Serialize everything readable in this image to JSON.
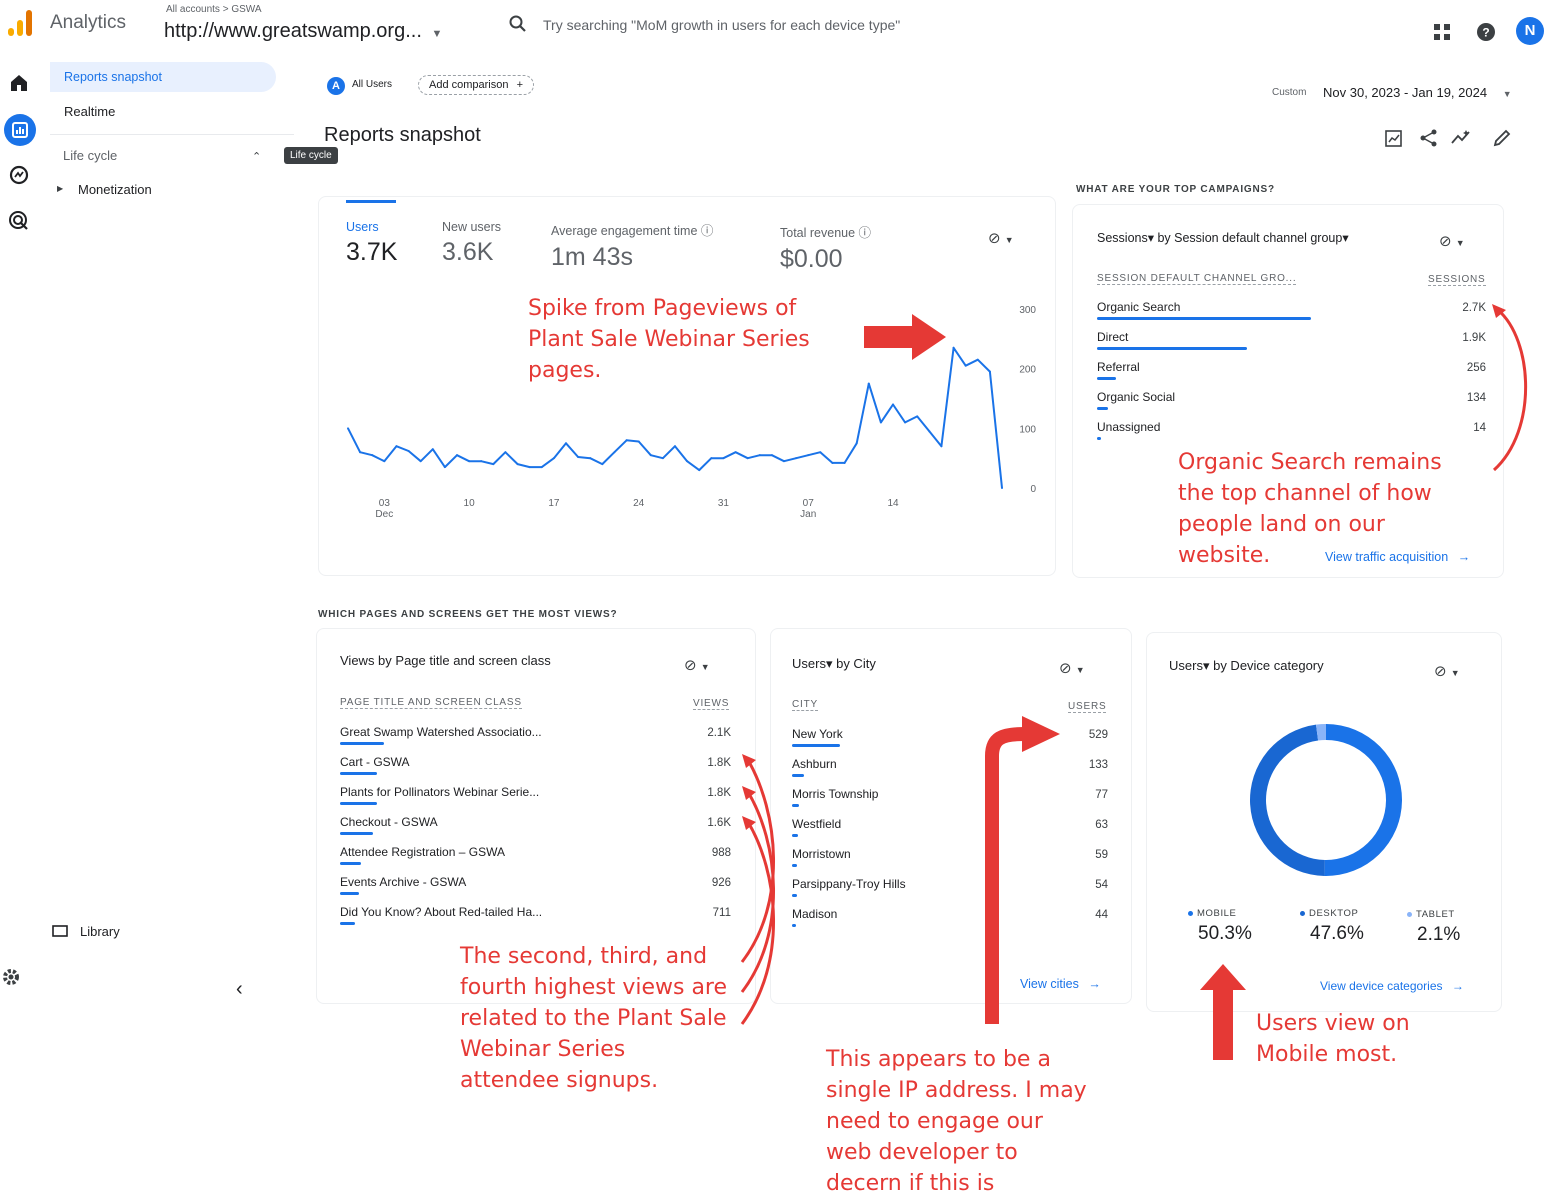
{
  "header": {
    "app_title": "Analytics",
    "breadcrumb": "All accounts > GSWA",
    "property": "http://www.greatswamp.org...",
    "search_placeholder": "Try searching \"MoM growth in users for each device type\"",
    "avatar_letter": "N"
  },
  "nav": {
    "reports_snapshot": "Reports snapshot",
    "realtime": "Realtime",
    "life_cycle": "Life cycle",
    "monetization": "Monetization",
    "library": "Library",
    "tooltip": "Life cycle"
  },
  "toolbar": {
    "segment_letter": "A",
    "segment_label": "All Users",
    "add_comparison": "Add comparison",
    "page_title": "Reports snapshot",
    "date_custom": "Custom",
    "date_range": "Nov 30, 2023 - Jan 19, 2024"
  },
  "metrics": [
    {
      "label": "Users",
      "value": "3.7K"
    },
    {
      "label": "New users",
      "value": "3.6K"
    },
    {
      "label": "Average engagement time",
      "value": "1m 43s"
    },
    {
      "label": "Total revenue",
      "value": "$0.00"
    }
  ],
  "chart_data": {
    "type": "line",
    "x_ticks": [
      "03 Dec",
      "10",
      "17",
      "24",
      "31",
      "07 Jan",
      "14"
    ],
    "y_ticks": [
      "300",
      "200",
      "100",
      "0"
    ],
    "ylim": [
      0,
      300
    ],
    "series": [
      {
        "values": [
          100,
          60,
          55,
          45,
          70,
          62,
          45,
          65,
          35,
          55,
          45,
          45,
          40,
          60,
          40,
          35,
          35,
          50,
          75,
          52,
          50,
          40,
          60,
          80,
          78,
          55,
          50,
          70,
          45,
          30,
          50,
          50,
          60,
          50,
          55,
          55,
          45,
          50,
          55,
          60,
          42,
          42,
          75,
          175,
          110,
          140,
          110,
          120,
          95,
          70,
          235,
          205,
          215,
          195,
          0
        ]
      }
    ]
  },
  "campaigns": {
    "section_title": "WHAT ARE YOUR TOP CAMPAIGNS?",
    "card_title": "Sessions▾ by Session default channel group▾",
    "col1": "SESSION DEFAULT CHANNEL GRO...",
    "col2": "SESSIONS",
    "rows": [
      {
        "label": "Organic Search",
        "value": "2.7K",
        "frac": 1.0
      },
      {
        "label": "Direct",
        "value": "1.9K",
        "frac": 0.7
      },
      {
        "label": "Referral",
        "value": "256",
        "frac": 0.09
      },
      {
        "label": "Organic Social",
        "value": "134",
        "frac": 0.05
      },
      {
        "label": "Unassigned",
        "value": "14",
        "frac": 0.01
      }
    ],
    "link": "View traffic acquisition"
  },
  "pages": {
    "section_title": "WHICH PAGES AND SCREENS GET THE MOST VIEWS?",
    "card_title": "Views by Page title and screen class",
    "col1": "PAGE TITLE AND SCREEN CLASS",
    "col2": "VIEWS",
    "rows": [
      {
        "label": "Great Swamp Watershed Associatio...",
        "value": "2.1K",
        "frac": 1.0
      },
      {
        "label": "Cart - GSWA",
        "value": "1.8K",
        "frac": 0.85
      },
      {
        "label": "Plants for Pollinators Webinar Serie...",
        "value": "1.8K",
        "frac": 0.85
      },
      {
        "label": "Checkout - GSWA",
        "value": "1.6K",
        "frac": 0.76
      },
      {
        "label": "Attendee Registration – GSWA",
        "value": "988",
        "frac": 0.47
      },
      {
        "label": "Events Archive - GSWA",
        "value": "926",
        "frac": 0.44
      },
      {
        "label": "Did You Know? About Red-tailed Ha...",
        "value": "711",
        "frac": 0.34
      }
    ]
  },
  "cities": {
    "card_title": "Users▾ by City",
    "col1": "CITY",
    "col2": "USERS",
    "rows": [
      {
        "label": "New York",
        "value": "529",
        "frac": 1.0
      },
      {
        "label": "Ashburn",
        "value": "133",
        "frac": 0.25
      },
      {
        "label": "Morris Township",
        "value": "77",
        "frac": 0.15
      },
      {
        "label": "Westfield",
        "value": "63",
        "frac": 0.12
      },
      {
        "label": "Morristown",
        "value": "59",
        "frac": 0.11
      },
      {
        "label": "Parsippany-Troy Hills",
        "value": "54",
        "frac": 0.1
      },
      {
        "label": "Madison",
        "value": "44",
        "frac": 0.08
      }
    ],
    "link": "View cities"
  },
  "devices": {
    "card_title": "Users▾ by Device category",
    "segments": [
      {
        "label": "MOBILE",
        "value": "50.3%",
        "pct": 50.3,
        "color": "#1a73e8"
      },
      {
        "label": "DESKTOP",
        "value": "47.6%",
        "pct": 47.6,
        "color": "#1967d2"
      },
      {
        "label": "TABLET",
        "value": "2.1%",
        "pct": 2.1,
        "color": "#8ab4f8"
      }
    ],
    "link": "View device categories"
  },
  "annotations": {
    "spike": "Spike from Pageviews of Plant Sale Webinar Series pages.",
    "organic": "Organic Search remains the top channel of how people land on our website.",
    "views": "The second, third, and fourth highest views are related to the Plant Sale Webinar Series attendee signups.",
    "ip": "This appears to be a single IP address. I may need to engage our web developer to decern if this is legitimate.",
    "mobile": "Users view on Mobile most."
  },
  "colors": {
    "accent": "#1a73e8",
    "annotation": "#e53935"
  }
}
